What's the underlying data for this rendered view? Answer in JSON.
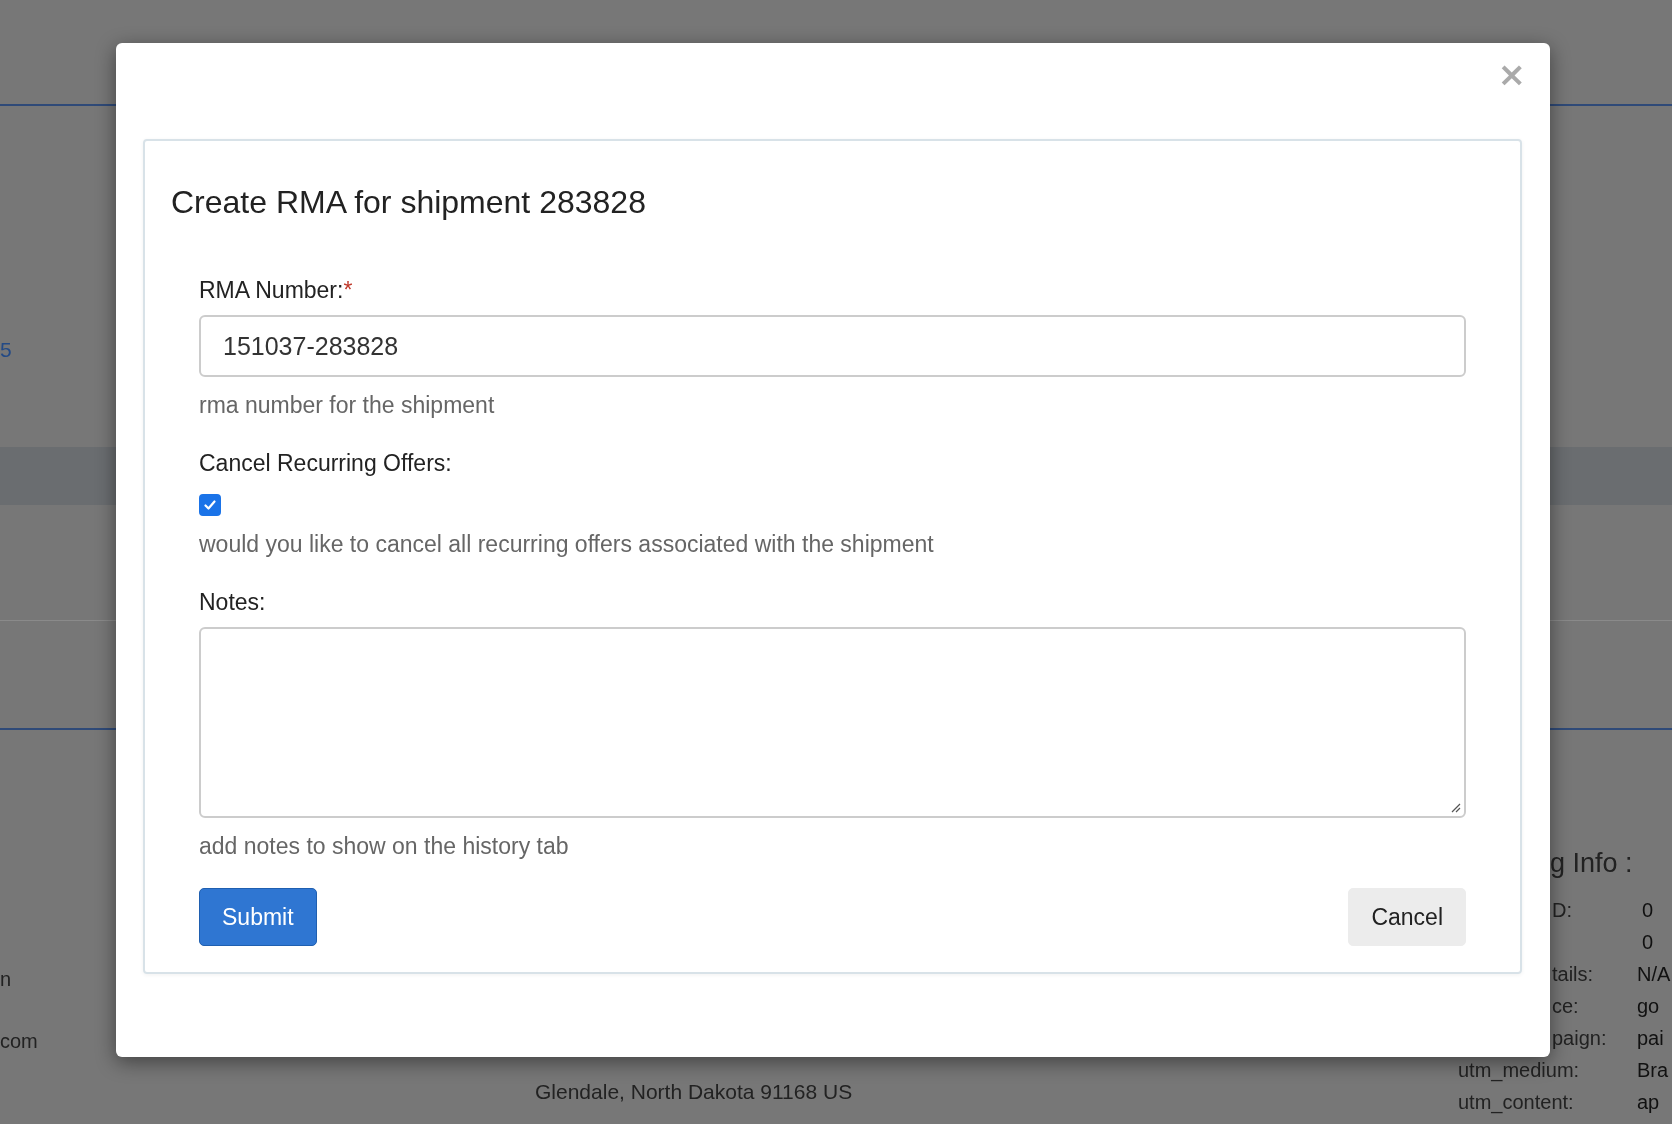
{
  "background": {
    "link_fragment": "5",
    "left_fragments": [
      "n",
      "com"
    ],
    "address": [
      "Glendale, North Dakota 91168 US"
    ],
    "info_heading": "g Info :",
    "info_rows": [
      {
        "label": "D:",
        "value": "0"
      },
      {
        "value": "0"
      },
      {
        "label": "tails:",
        "value": "N/A"
      },
      {
        "label": "ce:",
        "value": "go"
      },
      {
        "label": "paign:",
        "value": "pai"
      },
      {
        "label": "utm_medium:",
        "value": "Bra"
      },
      {
        "label": "utm_content:",
        "value": "ap"
      }
    ]
  },
  "modal": {
    "close": "×",
    "title": "Create RMA for shipment 283828",
    "fields": [
      {
        "kind": "text",
        "label": "RMA Number:",
        "required_mark": "*",
        "value": "151037-283828",
        "help": "rma number for the shipment"
      },
      {
        "kind": "checkbox",
        "label": "Cancel Recurring Offers:",
        "checked": true,
        "help": "would you like to cancel all recurring offers associated with the shipment"
      },
      {
        "kind": "textarea",
        "label": "Notes:",
        "help": "add notes to show on the history tab"
      }
    ],
    "buttons": [
      {
        "label": "Submit",
        "kind": "primary"
      },
      {
        "label": "Cancel",
        "kind": "secondary"
      }
    ]
  }
}
